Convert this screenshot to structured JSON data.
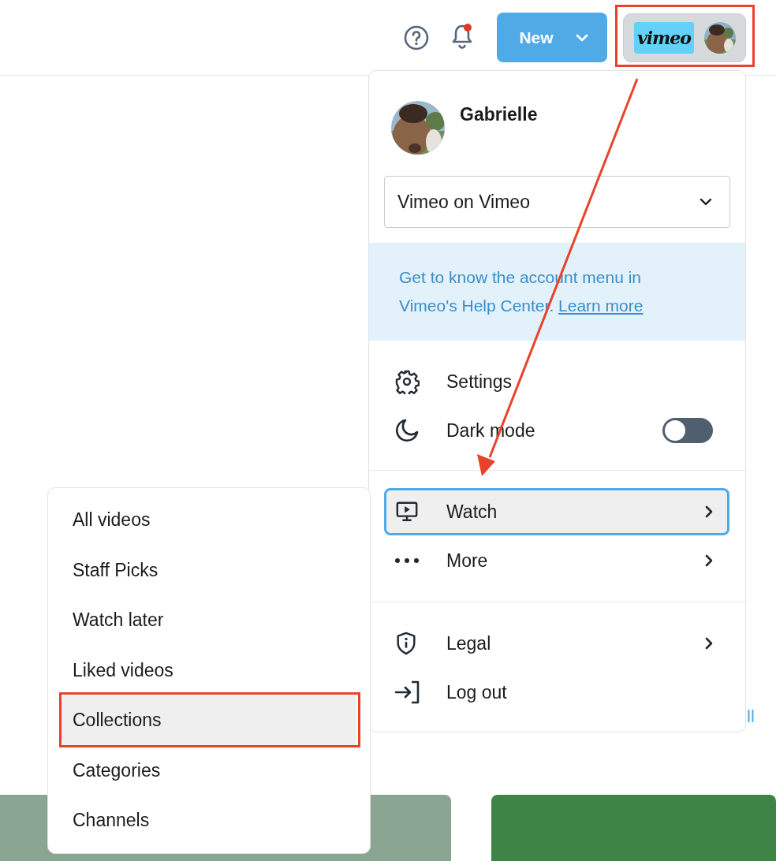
{
  "header": {
    "notifications_unread": true,
    "new_button": "New",
    "logo": "vimeo"
  },
  "account_menu": {
    "name": "Gabrielle",
    "team_select": "Vimeo on Vimeo",
    "help_text": "Get to know the account menu in Vimeo's Help Center.",
    "help_link": "Learn more",
    "sections": [
      [
        {
          "kind": "link",
          "label": "Settings",
          "selected": false
        },
        {
          "kind": "toggle",
          "label": "Dark mode",
          "on": false,
          "selected": false
        }
      ],
      [
        {
          "kind": "submenu",
          "label": "Watch",
          "selected": true
        },
        {
          "kind": "submenu",
          "label": "More",
          "selected": false
        }
      ],
      [
        {
          "kind": "submenu",
          "label": "Legal",
          "selected": false
        },
        {
          "kind": "link",
          "label": "Log out",
          "selected": false
        }
      ]
    ]
  },
  "submenu": {
    "items": [
      {
        "label": "All videos",
        "selected": false
      },
      {
        "label": "Staff Picks",
        "selected": false
      },
      {
        "label": "Watch later",
        "selected": false
      },
      {
        "label": "Liked videos",
        "selected": false
      },
      {
        "label": "Collections",
        "selected": true
      },
      {
        "label": "Categories",
        "selected": false
      },
      {
        "label": "Channels",
        "selected": false
      }
    ]
  },
  "partial_link": "ll",
  "callouts": {
    "account_button_box": true,
    "selected_item_box": true,
    "arrow_to_selected_item": true
  }
}
